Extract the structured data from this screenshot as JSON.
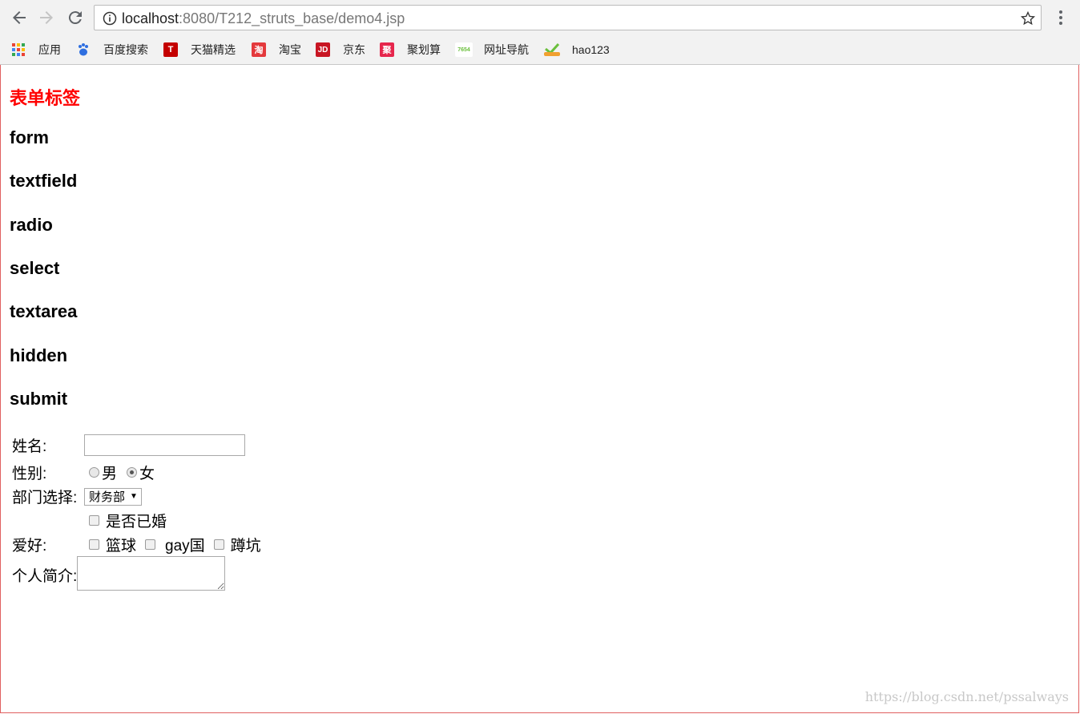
{
  "browser": {
    "url_host": "localhost",
    "url_path": ":8080/T212_struts_base/demo4.jsp",
    "bookmarks": [
      {
        "label": "应用",
        "icon": "apps-grid-icon"
      },
      {
        "label": "百度搜索",
        "icon": "baidu-paw-icon"
      },
      {
        "label": "天猫精选",
        "icon": "tmall-icon",
        "icon_text": "T",
        "color": "#c40000"
      },
      {
        "label": "淘宝",
        "icon": "taobao-icon",
        "icon_text": "淘",
        "color": "#e4393c"
      },
      {
        "label": "京东",
        "icon": "jd-icon",
        "icon_text": "JD",
        "color": "#c81623"
      },
      {
        "label": "聚划算",
        "icon": "juhuasuan-icon",
        "icon_text": "聚",
        "color": "#e6264c"
      },
      {
        "label": "网址导航",
        "icon": "7654-icon",
        "icon_text": "7654",
        "color": "#6abf3c"
      },
      {
        "label": "hao123",
        "icon": "hao123-icon"
      }
    ]
  },
  "page": {
    "title": "表单标签",
    "tags": [
      "form",
      "textfield",
      "radio",
      "select",
      "textarea",
      "hidden",
      "submit"
    ],
    "form": {
      "name_label": "姓名:",
      "name_value": "",
      "gender_label": "性别:",
      "gender_options": [
        "男",
        "女"
      ],
      "gender_selected": "女",
      "dept_label": "部门选择:",
      "dept_selected": "财务部",
      "married_label": "是否已婚",
      "hobby_label": "爱好:",
      "hobbies": [
        "篮球",
        "gay国",
        "蹲坑"
      ],
      "intro_label": "个人简介:"
    }
  },
  "watermark": "https://blog.csdn.net/pssalways"
}
